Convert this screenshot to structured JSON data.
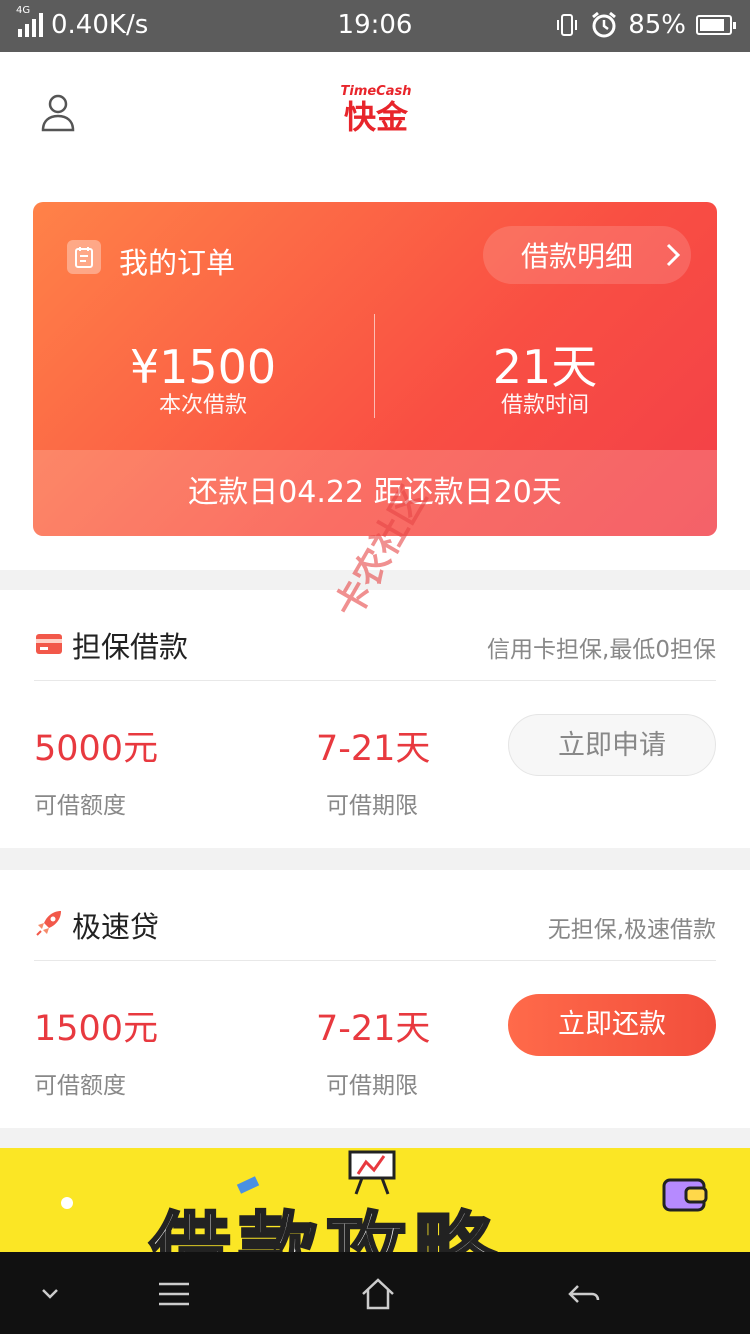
{
  "status_bar": {
    "network": "4G",
    "speed": "0.40K/s",
    "time": "19:06",
    "battery": "85%",
    "battery_level": 0.85,
    "icons": [
      "signal-icon",
      "vibrate-icon",
      "alarm-icon",
      "battery-icon"
    ]
  },
  "header": {
    "logo_en": "TimeCash",
    "logo_cn": "快金",
    "brand_color": "#e8252b"
  },
  "order": {
    "title": "我的订单",
    "detail_label": "借款明细",
    "amount_value": "¥1500",
    "amount_label": "本次借款",
    "duration_value": "21天",
    "duration_label": "借款时间",
    "due_text": "还款日04.22   距还款日20天"
  },
  "products": [
    {
      "name": "担保借款",
      "desc": "信用卡担保,最低0担保",
      "amount": "5000元",
      "amount_label": "可借额度",
      "term": "7-21天",
      "term_label": "可借期限",
      "button": "立即申请",
      "enabled": false
    },
    {
      "name": "极速贷",
      "desc": "无担保,极速借款",
      "amount": "1500元",
      "amount_label": "可借额度",
      "term": "7-21天",
      "term_label": "可借期限",
      "button": "立即还款",
      "enabled": true
    }
  ],
  "banner": {
    "text": "借款攻略"
  },
  "watermark": "卡农社区",
  "accent_color": "#f24e3c"
}
